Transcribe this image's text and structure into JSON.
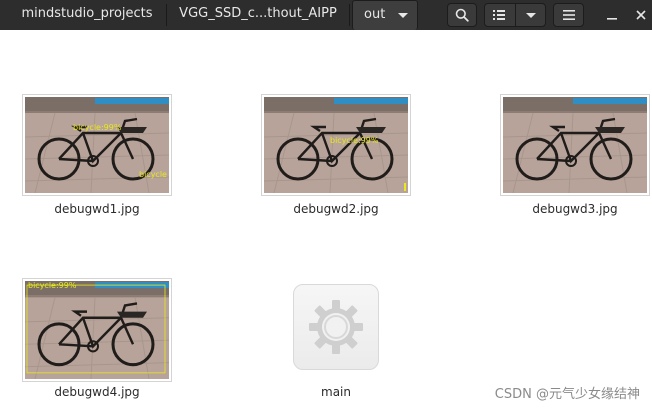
{
  "toolbar": {
    "breadcrumbs": [
      "mindstudio_projects",
      "VGG_SSD_c...thout_AIPP",
      "out"
    ],
    "icons": {
      "crumb_menu": "chevron-down-icon",
      "search": "search-icon",
      "view": "list-view-icon",
      "view_menu": "chevron-down-icon",
      "menu": "hamburger-menu-icon",
      "minimize": "minimize-icon",
      "close": "close-icon"
    }
  },
  "files": [
    {
      "name": "debugwd1.jpg",
      "type": "image",
      "detections": [
        "bicycle:99%",
        "bicycle"
      ]
    },
    {
      "name": "debugwd2.jpg",
      "type": "image",
      "detections": [
        "bicycle:99%"
      ]
    },
    {
      "name": "debugwd3.jpg",
      "type": "image",
      "detections": []
    },
    {
      "name": "debugwd4.jpg",
      "type": "image",
      "detections": [
        "bicycle:99%"
      ]
    },
    {
      "name": "main",
      "type": "executable",
      "icon": "gear-icon"
    }
  ],
  "watermark": "CSDN @元气少女缘结神",
  "colors": {
    "header": "#2d2d2d",
    "detection_label": "#e8e81a",
    "background": "#ffffff"
  }
}
